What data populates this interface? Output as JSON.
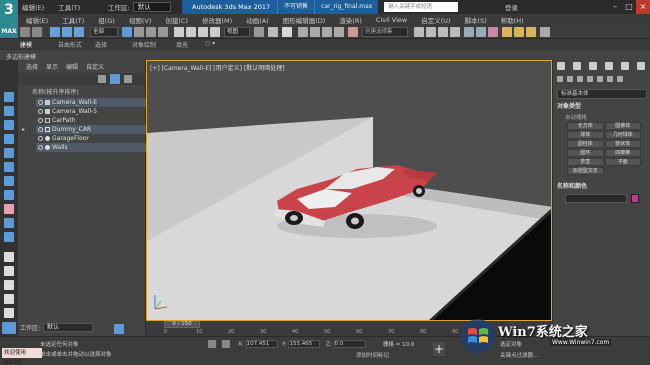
{
  "app": {
    "logo_digit": "3",
    "logo_caption": "MAX",
    "title": "Autodesk 3ds Max 2017",
    "title_tabs": [
      "不可销售",
      "car_rig_final.max"
    ],
    "search_placeholder": "键入关键字或短语",
    "login": "登录"
  },
  "quick_access": {
    "menu_items": [
      "编辑(E)",
      "工具(T)"
    ],
    "workspace_label": "工作区:",
    "workspace_value": "默认"
  },
  "menubar": {
    "items": [
      "编辑(E)",
      "工具(T)",
      "组(G)",
      "视图(V)",
      "创建(C)",
      "修改器(M)",
      "动画(A)",
      "图形编辑器(D)",
      "渲染(R)",
      "Civil View",
      "自定义(U)",
      "脚本(S)",
      "帮助(H)"
    ]
  },
  "main_toolbar": {
    "filter_value": "全部",
    "view_value": "视图",
    "selection_set_placeholder": "创建选择集"
  },
  "ribbon": {
    "tabs": [
      "建模",
      "自由形式",
      "选择",
      "对象绘制",
      "填充"
    ],
    "sub_label": "多边形建模"
  },
  "explorer": {
    "menu": [
      "选择",
      "显示",
      "编辑",
      "自定义"
    ],
    "column_header": "名称(按升序排序)",
    "objects": [
      {
        "name": "Camera_Wall-E",
        "type": "camera",
        "selected": true
      },
      {
        "name": "Camera_Wall-5",
        "type": "camera",
        "selected": false
      },
      {
        "name": "CarPath",
        "type": "shape",
        "selected": false
      },
      {
        "name": "Dummy_CAR",
        "type": "dummy",
        "selected": true
      },
      {
        "name": "GarageFloor",
        "type": "geometry",
        "selected": false
      },
      {
        "name": "Walls",
        "type": "geometry",
        "selected": true
      }
    ],
    "workspace_label": "工作区:",
    "workspace_value": "默认"
  },
  "viewport": {
    "label": "[+] [Camera_Wall-E] [用户定义] [默认明暗处理]",
    "car_color": "#c9434a",
    "frame_color": "#d9a52a"
  },
  "command_panel": {
    "dropdown_value": "标准基本体",
    "object_type_title": "对象类型",
    "autogrid_label": "自动栅格",
    "objects": [
      "长方体",
      "圆锥体",
      "球体",
      "几何球体",
      "圆柱体",
      "管状体",
      "圆环",
      "四棱锥",
      "茶壶",
      "平面",
      "加强型文本"
    ],
    "name_color_title": "名称和颜色",
    "swatch_color": "#c23b8f"
  },
  "timeline": {
    "frame_display": "0 / 150",
    "ticks": [
      "0",
      "10",
      "20",
      "30",
      "40",
      "50",
      "60",
      "70",
      "80",
      "90",
      "100",
      "110"
    ]
  },
  "statusbar": {
    "maxscript_label": "欢迎使用 MAXSc",
    "status_line1": "未选定任何对象",
    "status_line2": "单击或单击并拖动以选择对象",
    "x_label": "X:",
    "x_value": "107.451",
    "y_label": "Y:",
    "y_value": "155.465",
    "z_label": "Z:",
    "z_value": "0.0",
    "grid_label": "栅格 = 10.0",
    "add_time_tag": "添加时间标记",
    "selected_label": "选定对象",
    "key_filter": "关键点过滤器..."
  },
  "watermark": {
    "brand": "Win7系统之家",
    "url": "Www.Winwin7.com"
  }
}
